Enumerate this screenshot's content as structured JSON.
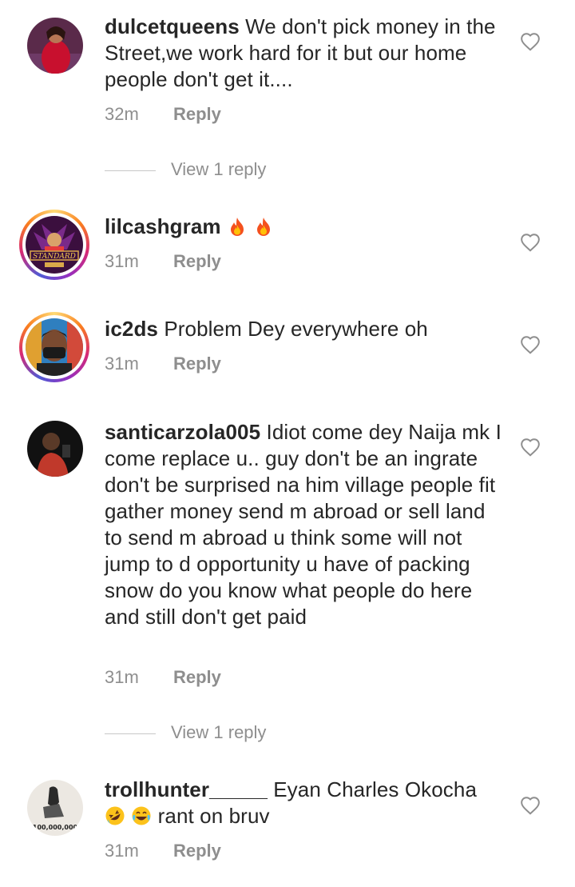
{
  "comments": [
    {
      "username": "dulcetqueens",
      "text": "We don't pick money in the Street,we work hard for it but our home people don't get it....",
      "time": "32m",
      "reply_label": "Reply",
      "view_replies": "View 1 reply"
    },
    {
      "username": "lilcashgram",
      "text": "",
      "emojis": [
        "fire-emoji",
        "fire-emoji"
      ],
      "time": "31m",
      "reply_label": "Reply",
      "avatar_ring_text": "STANDARD"
    },
    {
      "username": "ic2ds",
      "text": "Problem Dey everywhere oh",
      "time": "31m",
      "reply_label": "Reply"
    },
    {
      "username": "santicarzola005",
      "text": "Idiot come dey Naija mk I come replace u.. guy don't be an ingrate don't be surprised na him village people fit gather money send m abroad or sell land to send m abroad  u think some will not jump to d opportunity u have of packing snow do you know what people do here and still don't get paid",
      "time": "31m",
      "reply_label": "Reply",
      "view_replies": "View 1 reply"
    },
    {
      "username": "trollhunter_____",
      "text": "Eyan Charles Okocha",
      "text_after_emojis": "rant on bruv",
      "emojis": [
        "rolling-laughing-emoji",
        "tears-of-joy-emoji"
      ],
      "time": "31m",
      "reply_label": "Reply",
      "avatar_caption": "100,000,000"
    }
  ],
  "colors": {
    "text": "#262626",
    "muted": "#8e8e8e",
    "divider": "#c7c7c7"
  }
}
